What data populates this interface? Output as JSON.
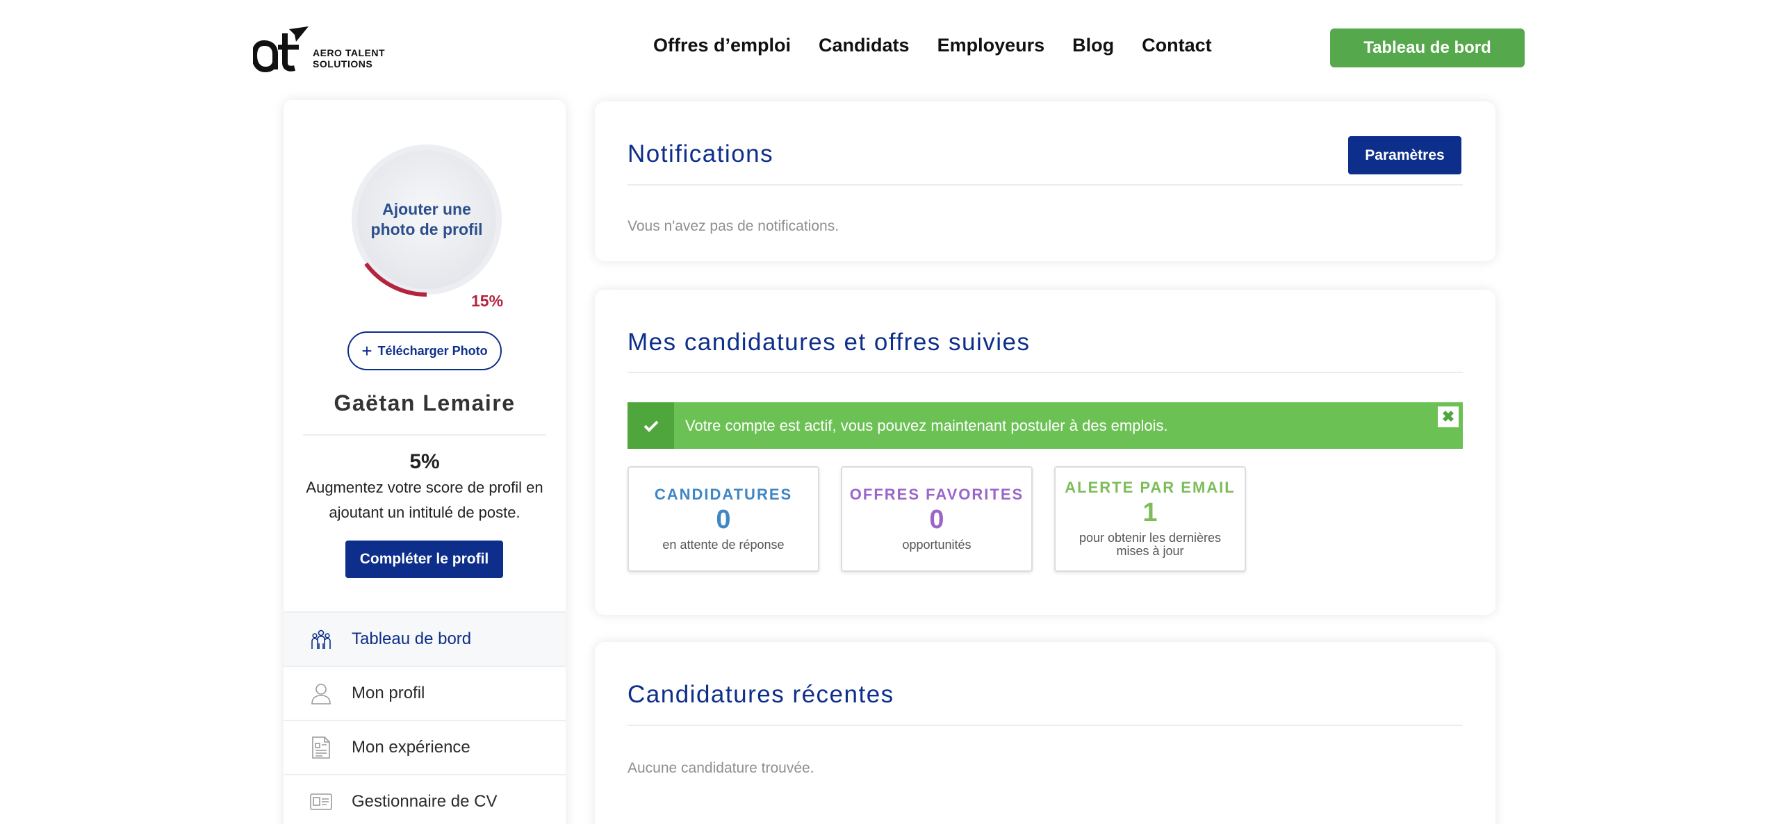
{
  "header": {
    "logo_text_line1": "AERO TALENT",
    "logo_text_line2": "SOLUTIONS",
    "nav": [
      "Offres d’emploi",
      "Candidats",
      "Employeurs",
      "Blog",
      "Contact"
    ],
    "dashboard_button": "Tableau de bord",
    "accent_color": "#56a84c"
  },
  "sidebar": {
    "avatar_placeholder": "Ajouter une photo de profil",
    "photo_progress_percent": 15,
    "photo_progress_label": "15%",
    "upload_button": "Télécharger Photo",
    "user_name": "Gaëtan Lemaire",
    "score_percent": "5%",
    "score_text": "Augmentez votre score de profil en ajoutant un intitulé de poste.",
    "complete_button": "Compléter le profil",
    "menu": [
      {
        "label": "Tableau de bord",
        "icon": "team-icon",
        "active": true
      },
      {
        "label": "Mon profil",
        "icon": "user-icon",
        "active": false
      },
      {
        "label": "Mon expérience",
        "icon": "document-icon",
        "active": false
      },
      {
        "label": "Gestionnaire de CV",
        "icon": "id-card-icon",
        "active": false
      }
    ],
    "primary_color": "#0d2e8a",
    "progress_color": "#b3253e"
  },
  "notifications": {
    "title": "Notifications",
    "settings_button": "Paramètres",
    "empty_text": "Vous n'avez pas de notifications."
  },
  "applications": {
    "title": "Mes candidatures et offres suivies",
    "alert_message": "Votre compte est actif, vous pouvez maintenant postuler à des emplois.",
    "alert_close": "✖",
    "stats": [
      {
        "title": "CANDIDATURES",
        "value": "0",
        "subtitle": "en attente de réponse",
        "color": "#3f86c4"
      },
      {
        "title": "OFFRES FAVORITES",
        "value": "0",
        "subtitle": "opportunités",
        "color": "#9a66c8"
      },
      {
        "title": "ALERTE PAR EMAIL",
        "value": "1",
        "subtitle": "pour obtenir les dernières mises à jour",
        "color": "#7cbd5a"
      }
    ]
  },
  "recent": {
    "title": "Candidatures récentes",
    "empty_text": "Aucune candidature trouvée."
  }
}
